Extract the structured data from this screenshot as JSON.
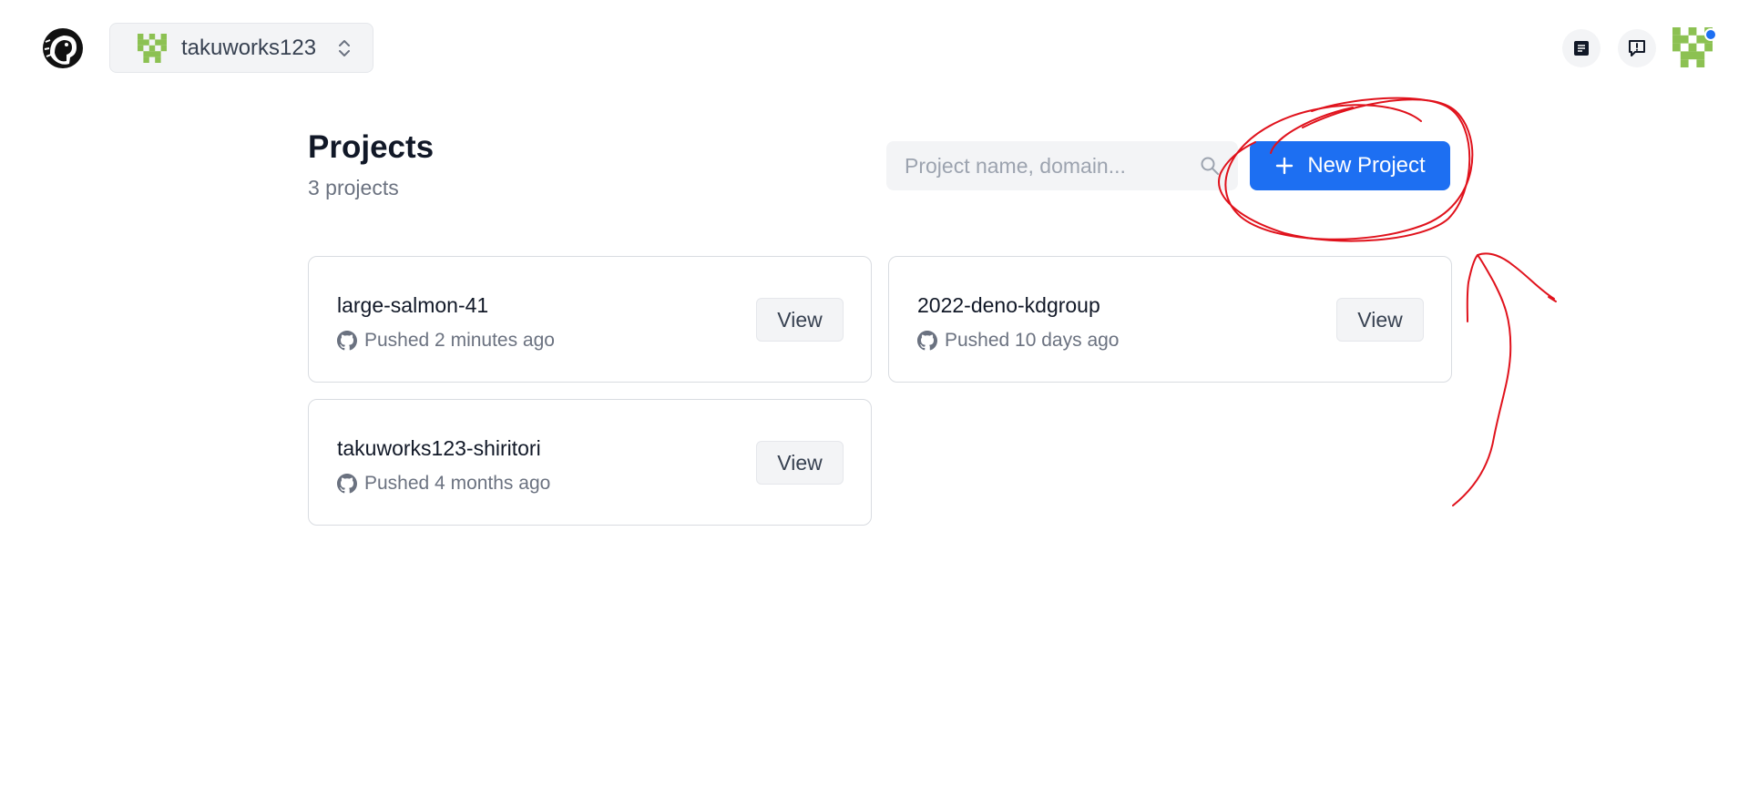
{
  "header": {
    "org_name": "takuworks123",
    "logo_icon": "deno-dinosaur-icon",
    "docs_icon": "document-icon",
    "feedback_icon": "feedback-icon"
  },
  "main": {
    "title": "Projects",
    "count_label": "3 projects",
    "search": {
      "placeholder": "Project name, domain...",
      "value": ""
    },
    "new_project_label": "New Project"
  },
  "projects": [
    {
      "name": "large-salmon-41",
      "status": "Pushed 2 minutes ago",
      "action": "View"
    },
    {
      "name": "2022-deno-kdgroup",
      "status": "Pushed 10 days ago",
      "action": "View"
    },
    {
      "name": "takuworks123-shiritori",
      "status": "Pushed 4 months ago",
      "action": "View"
    }
  ],
  "colors": {
    "accent": "#1d6ff2",
    "annotation": "#e0121c",
    "avatar_green": "#8cc152"
  }
}
